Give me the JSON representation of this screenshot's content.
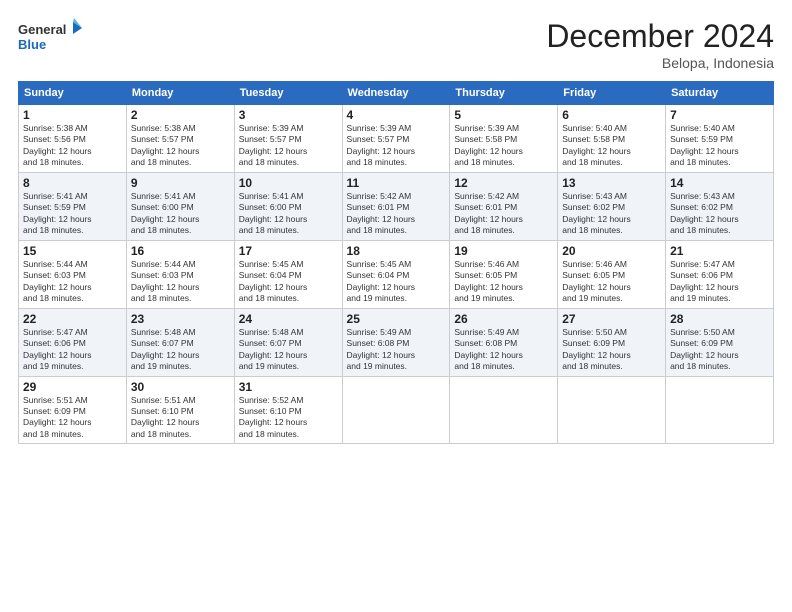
{
  "logo": {
    "line1": "General",
    "line2": "Blue"
  },
  "title": "December 2024",
  "subtitle": "Belopa, Indonesia",
  "days_header": [
    "Sunday",
    "Monday",
    "Tuesday",
    "Wednesday",
    "Thursday",
    "Friday",
    "Saturday"
  ],
  "weeks": [
    [
      {
        "day": "1",
        "info": "Sunrise: 5:38 AM\nSunset: 5:56 PM\nDaylight: 12 hours\nand 18 minutes."
      },
      {
        "day": "2",
        "info": "Sunrise: 5:38 AM\nSunset: 5:57 PM\nDaylight: 12 hours\nand 18 minutes."
      },
      {
        "day": "3",
        "info": "Sunrise: 5:39 AM\nSunset: 5:57 PM\nDaylight: 12 hours\nand 18 minutes."
      },
      {
        "day": "4",
        "info": "Sunrise: 5:39 AM\nSunset: 5:57 PM\nDaylight: 12 hours\nand 18 minutes."
      },
      {
        "day": "5",
        "info": "Sunrise: 5:39 AM\nSunset: 5:58 PM\nDaylight: 12 hours\nand 18 minutes."
      },
      {
        "day": "6",
        "info": "Sunrise: 5:40 AM\nSunset: 5:58 PM\nDaylight: 12 hours\nand 18 minutes."
      },
      {
        "day": "7",
        "info": "Sunrise: 5:40 AM\nSunset: 5:59 PM\nDaylight: 12 hours\nand 18 minutes."
      }
    ],
    [
      {
        "day": "8",
        "info": "Sunrise: 5:41 AM\nSunset: 5:59 PM\nDaylight: 12 hours\nand 18 minutes."
      },
      {
        "day": "9",
        "info": "Sunrise: 5:41 AM\nSunset: 6:00 PM\nDaylight: 12 hours\nand 18 minutes."
      },
      {
        "day": "10",
        "info": "Sunrise: 5:41 AM\nSunset: 6:00 PM\nDaylight: 12 hours\nand 18 minutes."
      },
      {
        "day": "11",
        "info": "Sunrise: 5:42 AM\nSunset: 6:01 PM\nDaylight: 12 hours\nand 18 minutes."
      },
      {
        "day": "12",
        "info": "Sunrise: 5:42 AM\nSunset: 6:01 PM\nDaylight: 12 hours\nand 18 minutes."
      },
      {
        "day": "13",
        "info": "Sunrise: 5:43 AM\nSunset: 6:02 PM\nDaylight: 12 hours\nand 18 minutes."
      },
      {
        "day": "14",
        "info": "Sunrise: 5:43 AM\nSunset: 6:02 PM\nDaylight: 12 hours\nand 18 minutes."
      }
    ],
    [
      {
        "day": "15",
        "info": "Sunrise: 5:44 AM\nSunset: 6:03 PM\nDaylight: 12 hours\nand 18 minutes."
      },
      {
        "day": "16",
        "info": "Sunrise: 5:44 AM\nSunset: 6:03 PM\nDaylight: 12 hours\nand 18 minutes."
      },
      {
        "day": "17",
        "info": "Sunrise: 5:45 AM\nSunset: 6:04 PM\nDaylight: 12 hours\nand 18 minutes."
      },
      {
        "day": "18",
        "info": "Sunrise: 5:45 AM\nSunset: 6:04 PM\nDaylight: 12 hours\nand 19 minutes."
      },
      {
        "day": "19",
        "info": "Sunrise: 5:46 AM\nSunset: 6:05 PM\nDaylight: 12 hours\nand 19 minutes."
      },
      {
        "day": "20",
        "info": "Sunrise: 5:46 AM\nSunset: 6:05 PM\nDaylight: 12 hours\nand 19 minutes."
      },
      {
        "day": "21",
        "info": "Sunrise: 5:47 AM\nSunset: 6:06 PM\nDaylight: 12 hours\nand 19 minutes."
      }
    ],
    [
      {
        "day": "22",
        "info": "Sunrise: 5:47 AM\nSunset: 6:06 PM\nDaylight: 12 hours\nand 19 minutes."
      },
      {
        "day": "23",
        "info": "Sunrise: 5:48 AM\nSunset: 6:07 PM\nDaylight: 12 hours\nand 19 minutes."
      },
      {
        "day": "24",
        "info": "Sunrise: 5:48 AM\nSunset: 6:07 PM\nDaylight: 12 hours\nand 19 minutes."
      },
      {
        "day": "25",
        "info": "Sunrise: 5:49 AM\nSunset: 6:08 PM\nDaylight: 12 hours\nand 19 minutes."
      },
      {
        "day": "26",
        "info": "Sunrise: 5:49 AM\nSunset: 6:08 PM\nDaylight: 12 hours\nand 18 minutes."
      },
      {
        "day": "27",
        "info": "Sunrise: 5:50 AM\nSunset: 6:09 PM\nDaylight: 12 hours\nand 18 minutes."
      },
      {
        "day": "28",
        "info": "Sunrise: 5:50 AM\nSunset: 6:09 PM\nDaylight: 12 hours\nand 18 minutes."
      }
    ],
    [
      {
        "day": "29",
        "info": "Sunrise: 5:51 AM\nSunset: 6:09 PM\nDaylight: 12 hours\nand 18 minutes."
      },
      {
        "day": "30",
        "info": "Sunrise: 5:51 AM\nSunset: 6:10 PM\nDaylight: 12 hours\nand 18 minutes."
      },
      {
        "day": "31",
        "info": "Sunrise: 5:52 AM\nSunset: 6:10 PM\nDaylight: 12 hours\nand 18 minutes."
      },
      null,
      null,
      null,
      null
    ]
  ]
}
